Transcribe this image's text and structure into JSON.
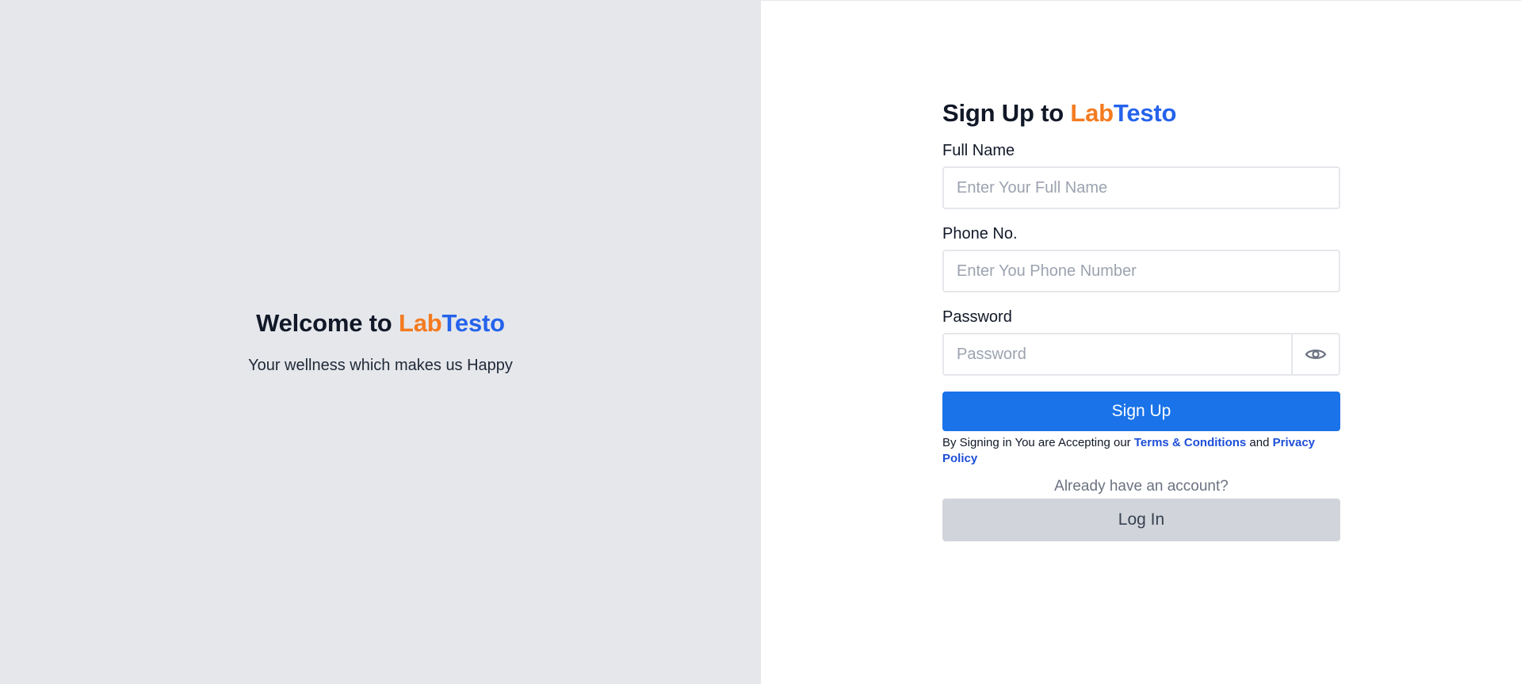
{
  "left": {
    "welcome_prefix": "Welcome to ",
    "brand_lab": "Lab",
    "brand_testo": "Testo",
    "tagline": "Your wellness which makes us Happy"
  },
  "form": {
    "title_prefix": "Sign Up to ",
    "brand_lab": "Lab",
    "brand_testo": "Testo",
    "full_name": {
      "label": "Full Name",
      "placeholder": "Enter Your Full Name",
      "value": ""
    },
    "phone": {
      "label": "Phone No.",
      "placeholder": "Enter You Phone Number",
      "value": ""
    },
    "password": {
      "label": "Password",
      "placeholder": "Password",
      "value": "",
      "toggle_icon": "eye-icon"
    },
    "signup_label": "Sign Up",
    "terms": {
      "prefix": "By Signing in You are Accepting our ",
      "terms_link": "Terms & Conditions",
      "middle": " and ",
      "privacy_link": "Privacy Policy"
    },
    "already_text": "Already have an account?",
    "login_label": "Log In"
  },
  "colors": {
    "brand_orange": "#f47b20",
    "brand_blue": "#2563eb",
    "primary_button": "#1a73e8",
    "secondary_button": "#d1d5db",
    "left_panel_bg": "#e5e7eb"
  }
}
